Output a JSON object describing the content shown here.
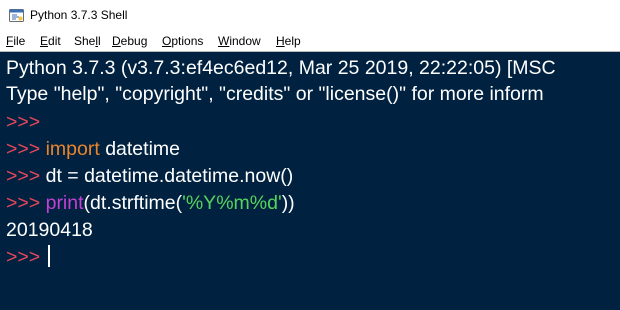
{
  "window": {
    "title": "Python 3.7.3 Shell",
    "icon": "python-idle-icon"
  },
  "menu": {
    "items": [
      {
        "mnemonic": "F",
        "rest": "ile"
      },
      {
        "mnemonic": "E",
        "rest": "dit"
      },
      {
        "pre": "She",
        "mnemonic": "l",
        "rest": "l"
      },
      {
        "mnemonic": "D",
        "rest": "ebug"
      },
      {
        "mnemonic": "O",
        "rest": "ptions"
      },
      {
        "mnemonic": "W",
        "rest": "indow"
      },
      {
        "mnemonic": "H",
        "rest": "elp"
      }
    ]
  },
  "shell": {
    "banner_line1": "Python 3.7.3 (v3.7.3:ef4ec6ed12, Mar 25 2019, 22:22:05) [MSC",
    "banner_line2": "Type \"help\", \"copyright\", \"credits\" or \"license()\" for more inform",
    "prompt": ">>> ",
    "cmd2_keyword": "import",
    "cmd2_rest": " datetime",
    "cmd3": "dt = datetime.datetime.now()",
    "cmd4_builtin": "print",
    "cmd4_mid": "(dt.strftime(",
    "cmd4_string": "'%Y%m%d'",
    "cmd4_end": "))",
    "output": "20190418"
  },
  "colors": {
    "background": "#002240",
    "prompt": "#e8475b",
    "keyword": "#e8842c",
    "builtin": "#c33fd6",
    "string": "#55d45d",
    "text": "#ffffff"
  }
}
